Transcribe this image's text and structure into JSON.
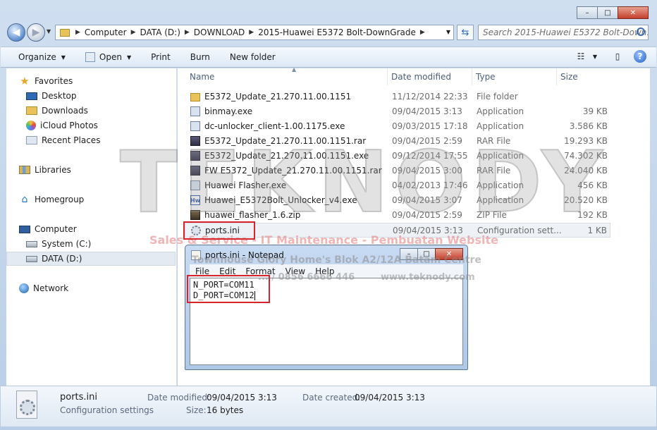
{
  "window_controls": {
    "minimize": "–",
    "maximize": "□",
    "close": "✕"
  },
  "nav": {
    "back": "◀",
    "forward": "▶",
    "recent": "▼"
  },
  "address": {
    "crumbs": [
      "Computer",
      "DATA (D:)",
      "DOWNLOAD",
      "2015-Huawei E5372 Bolt-DownGrade"
    ],
    "separator": "▶",
    "dropdown": "▼"
  },
  "refresh_glyph": "⇆",
  "search": {
    "placeholder": "Search 2015-Huawei E5372 Bolt-Down..."
  },
  "toolbar": {
    "organize": "Organize",
    "open": "Open",
    "print": "Print",
    "burn": "Burn",
    "new_folder": "New folder",
    "caret": "▼",
    "views_glyph": "☷",
    "preview_glyph": "▯",
    "help_glyph": "?"
  },
  "sidebar": {
    "favorites": "Favorites",
    "desktop": "Desktop",
    "downloads": "Downloads",
    "icloud": "iCloud Photos",
    "recent": "Recent Places",
    "libraries": "Libraries",
    "homegroup": "Homegroup",
    "computer": "Computer",
    "system": "System (C:)",
    "data": "DATA (D:)",
    "network": "Network",
    "star_glyph": "★",
    "home_glyph": "⌂"
  },
  "columns": {
    "name": "Name",
    "date": "Date modified",
    "type": "Type",
    "size": "Size",
    "sort_glyph": "▲"
  },
  "files": [
    {
      "name": "E5372_Update_21.270.11.00.1151",
      "date": "11/12/2014 22:33",
      "type": "File folder",
      "size": "",
      "icon": "folder-icon"
    },
    {
      "name": "binmay.exe",
      "date": "09/04/2015 3:13",
      "type": "Application",
      "size": "39 KB",
      "icon": "exe-icon"
    },
    {
      "name": "dc-unlocker_client-1.00.1175.exe",
      "date": "09/03/2015 17:18",
      "type": "Application",
      "size": "3.586 KB",
      "icon": "exe-icon"
    },
    {
      "name": "E5372_Update_21.270.11.00.1151.rar",
      "date": "09/04/2015 2:59",
      "type": "RAR File",
      "size": "19.293 KB",
      "icon": "rar-icon"
    },
    {
      "name": "E5372_Update_21.270.11.00.1151.exe",
      "date": "09/12/2014 17:55",
      "type": "Application",
      "size": "74.302 KB",
      "icon": "rar-icon"
    },
    {
      "name": "FW E5372_Update_21.270.11.00.1151.rar",
      "date": "09/04/2015 3:00",
      "type": "RAR File",
      "size": "24.040 KB",
      "icon": "rar-icon"
    },
    {
      "name": "Huawei Flasher.exe",
      "date": "04/02/2013 17:46",
      "type": "Application",
      "size": "456 KB",
      "icon": "exe-icon"
    },
    {
      "name": "Huawei_E5372Bolt_Unlocker_v4.exe",
      "date": "09/04/2015 3:07",
      "type": "Application",
      "size": "20.520 KB",
      "icon": "hw-icon"
    },
    {
      "name": "huawei_flasher_1.6.zip",
      "date": "09/04/2015 2:59",
      "type": "ZIP File",
      "size": "192 KB",
      "icon": "zip-icon"
    },
    {
      "name": "ports.ini",
      "date": "09/04/2015 3:13",
      "type": "Configuration sett...",
      "size": "1 KB",
      "icon": "ini-icon"
    }
  ],
  "hw_icon_text": "Hw",
  "notepad": {
    "title": "ports.ini - Notepad",
    "menu": {
      "file": "File",
      "edit": "Edit",
      "format": "Format",
      "view": "View",
      "help": "Help"
    },
    "line1": "N_PORT=COM11",
    "line2": "D_PORT=COM12"
  },
  "details": {
    "filename": "ports.ini",
    "filetype": "Configuration settings",
    "date_modified_label": "Date modified:",
    "date_modified": "09/04/2015 3:13",
    "date_created_label": "Date created:",
    "date_created": "09/04/2015 3:13",
    "size_label": "Size:",
    "size": "16 bytes"
  },
  "watermark": {
    "brand": "TEKNODY",
    "tagline": "Sales & Service - IT Maintenance - Pembuatan Website",
    "address": "Townhouse Glory Home's Blok A2/12A Batam Centre",
    "phone": "... / 0856 6666 446",
    "site": "www.teknody.com"
  },
  "colors": {
    "accent": "#2f6ab5",
    "highlight_box": "#d9232a"
  }
}
